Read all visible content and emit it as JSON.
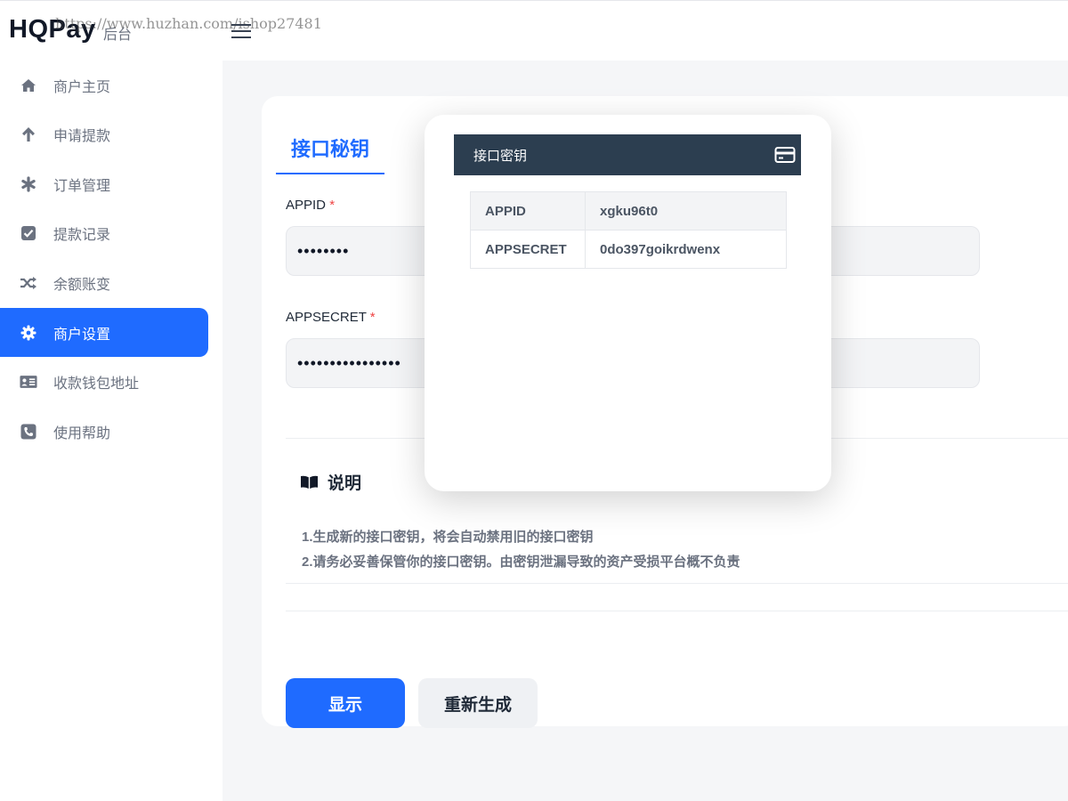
{
  "header": {
    "logo": "HQPay",
    "logo_suffix": "后台",
    "watermark": "https://www.huzhan.com/ishop27481",
    "menu_toggle_icon": "hamburger-icon"
  },
  "sidebar": {
    "items": [
      {
        "label": "商户主页",
        "icon": "home-icon",
        "active": false
      },
      {
        "label": "申请提款",
        "icon": "arrow-up-icon",
        "active": false
      },
      {
        "label": "订单管理",
        "icon": "asterisk-icon",
        "active": false
      },
      {
        "label": "提款记录",
        "icon": "checkbox-icon",
        "active": false
      },
      {
        "label": "余额账变",
        "icon": "shuffle-icon",
        "active": false
      },
      {
        "label": "商户设置",
        "icon": "gear-icon",
        "active": true
      },
      {
        "label": "收款钱包地址",
        "icon": "id-card-icon",
        "active": false
      },
      {
        "label": "使用帮助",
        "icon": "phone-icon",
        "active": false
      }
    ]
  },
  "main": {
    "tab_title": "接口秘钥",
    "appid": {
      "label": "APPID",
      "required_mark": "*",
      "value": "••••••••"
    },
    "appsecret": {
      "label": "APPSECRET",
      "required_mark": "*",
      "value": "••••••••••••••••"
    },
    "notes": {
      "title": "说明",
      "lines": [
        "1.生成新的接口密钥，将会自动禁用旧的接口密钥",
        "2.请务必妥善保管你的接口密钥。由密钥泄漏导致的资产受损平台概不负责"
      ]
    },
    "buttons": {
      "show": "显示",
      "regenerate": "重新生成"
    }
  },
  "modal": {
    "title": "接口密钥",
    "rows": [
      {
        "key": "APPID",
        "value": "xgku96t0"
      },
      {
        "key": "APPSECRET",
        "value": "0do397goikrdwenx"
      }
    ]
  },
  "colors": {
    "accent": "#1f6bff",
    "modal_header": "#2c3e50",
    "required": "#ef4444"
  }
}
